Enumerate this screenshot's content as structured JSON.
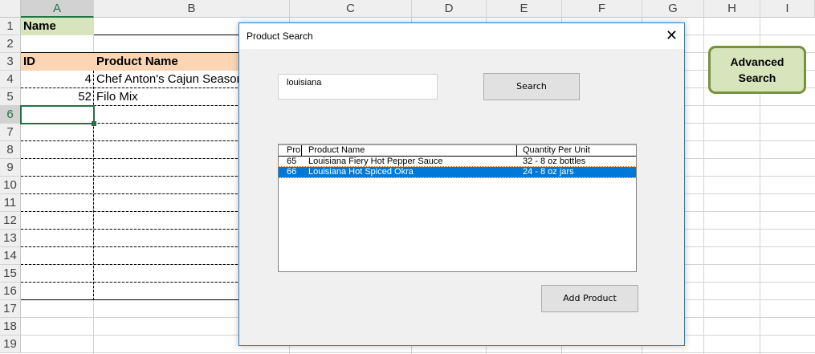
{
  "columns": [
    "A",
    "B",
    "C",
    "D",
    "E",
    "F",
    "G",
    "H",
    "I"
  ],
  "rows": [
    "1",
    "2",
    "3",
    "4",
    "5",
    "6",
    "7",
    "8",
    "9",
    "10",
    "11",
    "12",
    "13",
    "14",
    "15",
    "16",
    "17",
    "18",
    "19"
  ],
  "cells": {
    "a1": "Name",
    "a3": "ID",
    "b3": "Product Name",
    "a4": "4",
    "b4": "Chef Anton's Cajun Seasoni",
    "a5": "52",
    "b5": "Filo Mix"
  },
  "advanced_search_button": "Advanced Search",
  "dialog": {
    "title": "Product Search",
    "close": "✕",
    "search_value": "louisiana",
    "search_button": "Search",
    "list_headers": [
      "Pro",
      "Product Name",
      "Quantity Per Unit"
    ],
    "list_rows": [
      {
        "id": "65",
        "name": "Louisiana Fiery Hot Pepper Sauce",
        "qty": "32 - 8 oz bottles"
      },
      {
        "id": "66",
        "name": "Louisiana Hot Spiced Okra",
        "qty": "24 - 8 oz jars"
      }
    ],
    "add_button": "Add Product"
  },
  "colors": {
    "name_fill": "#d8e4bc",
    "header_fill": "#fcd5b4",
    "selection": "#0078d7",
    "excel_green": "#217346"
  }
}
